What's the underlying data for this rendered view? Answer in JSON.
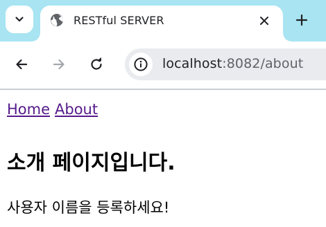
{
  "browser": {
    "tab": {
      "title": "RESTful SERVER",
      "favicon": "globe-icon"
    },
    "tab_search": {
      "icon": "chevron-down-icon"
    },
    "new_tab": {
      "icon": "plus-icon"
    },
    "toolbar": {
      "back_icon": "arrow-left-icon",
      "forward_icon": "arrow-right-icon",
      "reload_icon": "reload-icon",
      "site_info_icon": "info-icon",
      "url_host": "localhost",
      "url_rest": ":8082/about"
    },
    "colors": {
      "tab_strip": "#a8e4f2",
      "omnibox": "#e9ebee",
      "visited_link": "#551a8b"
    }
  },
  "page": {
    "nav": {
      "home_label": "Home",
      "about_label": "About"
    },
    "heading": "소개 페이지입니다.",
    "body_text": "사용자 이름을 등록하세요!"
  }
}
